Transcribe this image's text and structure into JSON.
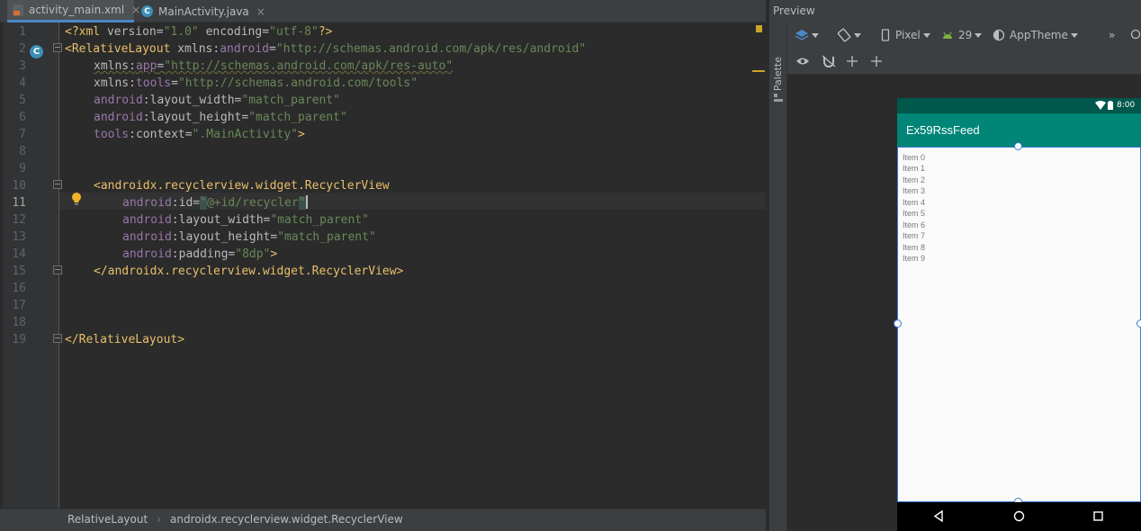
{
  "tabs": [
    {
      "label": "activity_main.xml",
      "close": "×"
    },
    {
      "label": "MainActivity.java",
      "close": "×"
    }
  ],
  "editor": {
    "line_numbers": [
      "1",
      "2",
      "3",
      "4",
      "5",
      "6",
      "7",
      "8",
      "9",
      "10",
      "11",
      "12",
      "13",
      "14",
      "15",
      "16",
      "17",
      "18",
      "19"
    ],
    "lines": {
      "l1": {
        "a": "<?xml ",
        "b": "version",
        "c": "=",
        "d": "\"1.0\"",
        "e": " ",
        "f": "encoding",
        "g": "=",
        "h": "\"utf-8\"",
        "i": "?>"
      },
      "l2": {
        "a": "<RelativeLayout ",
        "b": "xmlns:",
        "c": "android",
        "d": "=",
        "e": "\"http://schemas.android.com/apk/res/android\""
      },
      "l3": {
        "a": "xmlns:",
        "b": "app",
        "c": "=",
        "d": "\"http://schemas.android.com/apk/res-auto\""
      },
      "l4": {
        "a": "xmlns:",
        "b": "tools",
        "c": "=",
        "d": "\"http://schemas.android.com/tools\""
      },
      "l5": {
        "a": "android",
        "b": ":layout_width",
        "c": "=",
        "d": "\"match_parent\""
      },
      "l6": {
        "a": "android",
        "b": ":layout_height",
        "c": "=",
        "d": "\"match_parent\""
      },
      "l7": {
        "a": "tools",
        "b": ":context",
        "c": "=",
        "d": "\".MainActivity\"",
        "e": ">"
      },
      "l10": {
        "a": "<androidx.recyclerview.widget.RecyclerView"
      },
      "l11": {
        "a": "android",
        "b": ":id",
        "c": "=",
        "d": "\"",
        "e": "@+id/recycler",
        "f": "\""
      },
      "l12": {
        "a": "android",
        "b": ":layout_width",
        "c": "=",
        "d": "\"match_parent\""
      },
      "l13": {
        "a": "android",
        "b": ":layout_height",
        "c": "=",
        "d": "\"match_parent\""
      },
      "l14": {
        "a": "android",
        "b": ":padding",
        "c": "=",
        "d": "\"8dp\"",
        "e": ">"
      },
      "l15": {
        "a": "</androidx.recyclerview.widget.RecyclerView>"
      },
      "l19": {
        "a": "</RelativeLayout>"
      }
    }
  },
  "breadcrumb": {
    "item1": "RelativeLayout",
    "sep": "›",
    "item2": "androidx.recyclerview.widget.RecyclerView"
  },
  "preview": {
    "title": "Preview",
    "palette_label": "Palette",
    "device": "Pixel",
    "api": "29",
    "theme": "AppTheme",
    "more": "»"
  },
  "device": {
    "time": "8:00",
    "app_title": "Ex59RssFeed",
    "items": [
      "Item 0",
      "Item 1",
      "Item 2",
      "Item 3",
      "Item 4",
      "Item 5",
      "Item 6",
      "Item 7",
      "Item 8",
      "Item 9"
    ]
  },
  "colors": {
    "app_bar": "#008577",
    "status_bar": "#00574b",
    "selection": "#3d7bd4"
  }
}
